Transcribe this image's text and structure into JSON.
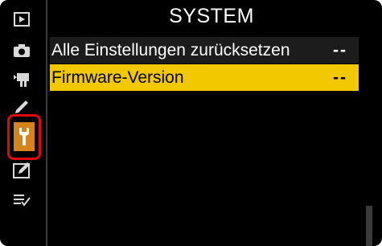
{
  "header": {
    "title": "SYSTEM"
  },
  "sidebar": {
    "items": [
      {
        "name": "playback-menu",
        "icon": "play-icon"
      },
      {
        "name": "photo-shooting-menu",
        "icon": "camera-icon"
      },
      {
        "name": "movie-shooting-menu",
        "icon": "movie-camera-icon"
      },
      {
        "name": "custom-settings-menu",
        "icon": "pencil-icon"
      },
      {
        "name": "setup-menu",
        "icon": "wrench-icon",
        "selected": true
      },
      {
        "name": "retouch-menu",
        "icon": "retouch-icon"
      },
      {
        "name": "my-menu",
        "icon": "my-menu-icon"
      }
    ]
  },
  "menu": {
    "rows": [
      {
        "label": "Alle Einstellungen zurücksetzen",
        "value": "--"
      },
      {
        "label": "Firmware-Version",
        "value": "--",
        "highlighted": true
      }
    ]
  },
  "colors": {
    "background": "#000000",
    "highlight": "#f2c800",
    "selected_tab": "#d7831c",
    "annotation_outline": "#e10a0a"
  }
}
